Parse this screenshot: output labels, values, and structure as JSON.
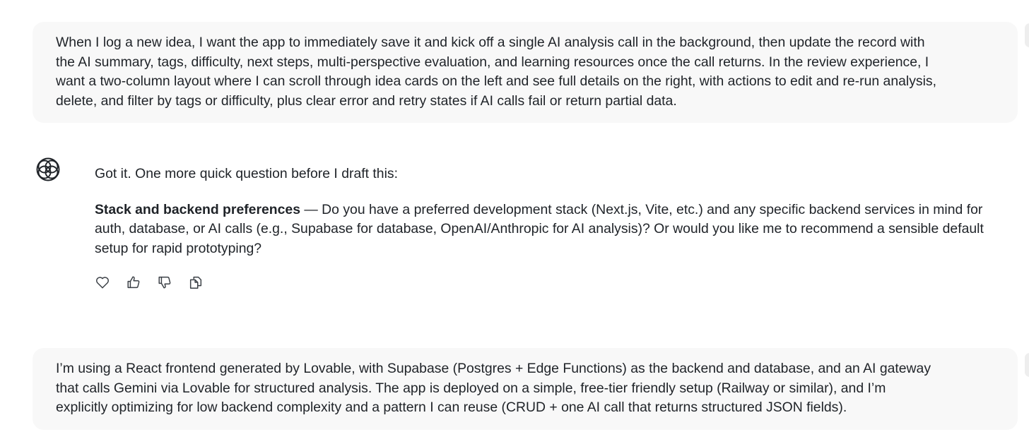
{
  "conversation": {
    "user_message_1": {
      "lines": [
        "When I log a new idea, I want the app to immediately save it and kick off a single AI analysis call in the background, then update the record with",
        "the AI summary, tags, difficulty, next steps, multi-perspective evaluation, and learning resources once the call returns. In the review experience, I",
        "want a two-column layout where I can scroll through idea cards on the left and see full details on the right, with actions to edit and re-run analysis,",
        "delete, and filter by tags or difficulty, plus clear error and retry states if AI calls fail or return partial data."
      ]
    },
    "assistant_message": {
      "intro": "Got it. One more quick question before I draft this:",
      "question_title": "Stack and backend preferences",
      "question_lines": [
        " — Do you have a preferred development stack (Next.js, Vite, etc.) and any specific backend services in mind for",
        "auth, database, or AI calls (e.g., Supabase for database, OpenAI/Anthropic for AI analysis)? Or would you like me to recommend a sensible default",
        "setup for rapid prototyping?"
      ],
      "actions": [
        {
          "name": "heart-icon"
        },
        {
          "name": "thumbs-up-icon"
        },
        {
          "name": "thumbs-down-icon"
        },
        {
          "name": "copy-icon"
        }
      ]
    },
    "user_message_2": {
      "lines": [
        "I’m using a React frontend generated by Lovable, with Supabase (Postgres + Edge Functions) as the backend and database, and an AI gateway",
        "that calls Gemini via Lovable for structured analysis. The app is deployed on a simple, free-tier friendly setup (Railway or similar), and I’m",
        "explicitly optimizing for low backend complexity and a pattern I can reuse (CRUD + one AI call that returns structured JSON fields)."
      ]
    }
  },
  "colors": {
    "bubble_bg": "#f8f8f8",
    "text": "#1f2328",
    "icon": "#3a3f45"
  }
}
